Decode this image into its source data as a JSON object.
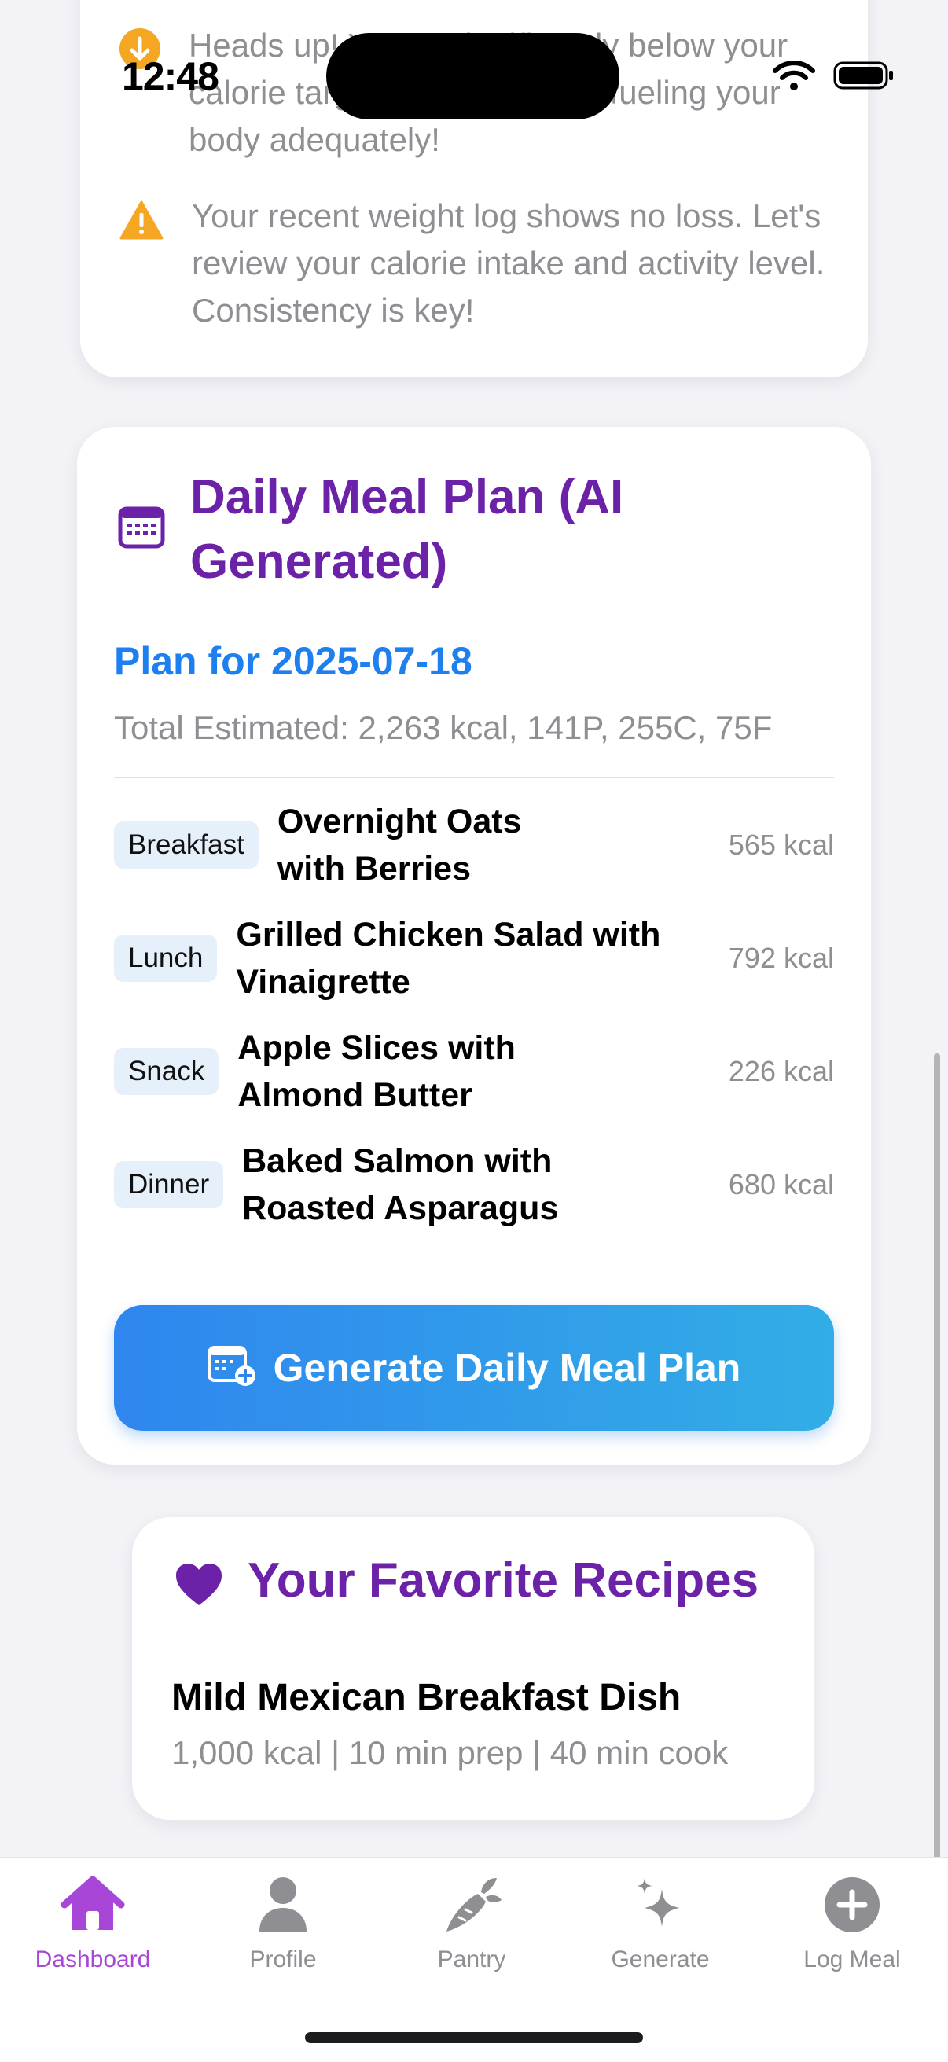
{
  "status_bar": {
    "time": "12:48"
  },
  "warnings": [
    {
      "icon": "arrow-down-circle-icon",
      "text": "Heads up! You're significantly below your calorie target. Ensure you're fueling your body adequately!"
    },
    {
      "icon": "warning-triangle-icon",
      "text": "Your recent weight log shows no loss. Let's review your calorie intake and activity level. Consistency is key!"
    }
  ],
  "meal_plan": {
    "title": "Daily Meal Plan (AI Generated)",
    "plan_date": "Plan for 2025-07-18",
    "total": "Total Estimated: 2,263 kcal, 141P, 255C, 75F",
    "meals": [
      {
        "type": "Breakfast",
        "name": "Overnight Oats with Berries",
        "kcal": "565 kcal"
      },
      {
        "type": "Lunch",
        "name": "Grilled Chicken Salad with Vinaigrette",
        "kcal": "792 kcal"
      },
      {
        "type": "Snack",
        "name": "Apple Slices with Almond Butter",
        "kcal": "226 kcal"
      },
      {
        "type": "Dinner",
        "name": "Baked Salmon with Roasted Asparagus",
        "kcal": "680 kcal"
      }
    ],
    "generate_label": "Generate Daily Meal Plan"
  },
  "favorites": {
    "title": "Your Favorite Recipes",
    "recipes": [
      {
        "name": "Mild Mexican Breakfast Dish",
        "meta": "1,000 kcal | 10 min prep | 40 min cook"
      }
    ]
  },
  "tabs": [
    {
      "label": "Dashboard",
      "icon": "house-icon",
      "active": true
    },
    {
      "label": "Profile",
      "icon": "person-icon",
      "active": false
    },
    {
      "label": "Pantry",
      "icon": "carrot-icon",
      "active": false
    },
    {
      "label": "Generate",
      "icon": "sparkles-icon",
      "active": false
    },
    {
      "label": "Log Meal",
      "icon": "plus-circle-icon",
      "active": false
    }
  ],
  "colors": {
    "accent_purple": "#6b21a8",
    "link_blue": "#1d7ff0",
    "active_tab": "#a846d8",
    "warning_orange": "#f5a623",
    "button_gradient_start": "#2f86ee",
    "button_gradient_end": "#32ade6"
  }
}
